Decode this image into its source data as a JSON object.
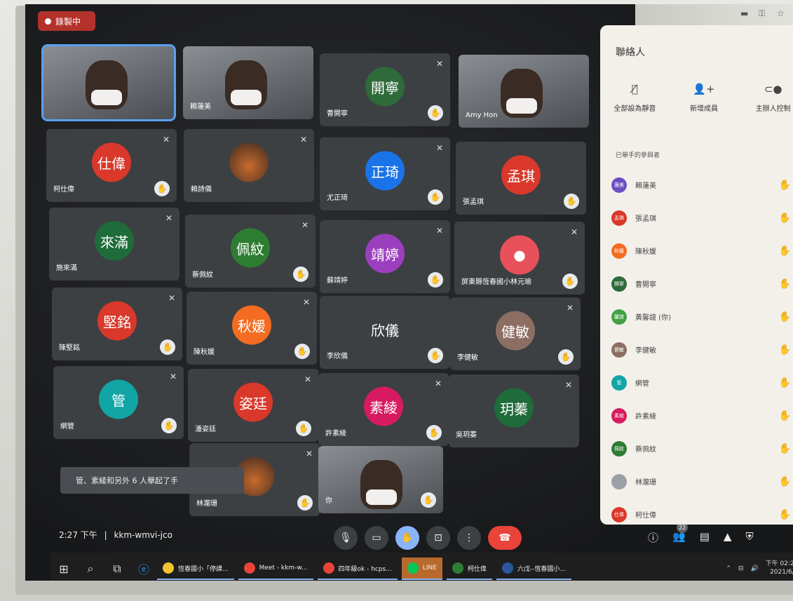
{
  "recording": {
    "label": "錄製中",
    "color": "#b3322b"
  },
  "browser": {
    "icons": [
      "ext-icon",
      "key-icon",
      "star-icon"
    ]
  },
  "tiles": [
    {
      "name": "",
      "type": "video",
      "active": true
    },
    {
      "name": "賴蓮美",
      "type": "video"
    },
    {
      "name": "曹開寧",
      "type": "avatar",
      "initials": "開寧",
      "color": "#2e6b3a",
      "muted": true,
      "hand": true
    },
    {
      "name": "Amy Hon",
      "type": "video"
    },
    {
      "name": "柯仕偉",
      "type": "avatar",
      "initials": "仕偉",
      "color": "#d9382b",
      "muted": true,
      "hand": true
    },
    {
      "name": "賴詩儀",
      "type": "photo",
      "muted": true
    },
    {
      "name": "尤正琦",
      "type": "avatar",
      "initials": "正琦",
      "color": "#1a73e8",
      "muted": true,
      "hand": true
    },
    {
      "name": "張孟琪",
      "type": "avatar",
      "initials": "孟琪",
      "color": "#d9382b",
      "hand": true
    },
    {
      "name": "施來滿",
      "type": "avatar",
      "initials": "來滿",
      "color": "#1f6b3a",
      "muted": true
    },
    {
      "name": "蔡佩紋",
      "type": "avatar",
      "initials": "佩紋",
      "color": "#2e7d32",
      "muted": true,
      "hand": true
    },
    {
      "name": "蘇靖婷",
      "type": "avatar",
      "initials": "靖婷",
      "color": "#9c3fbf",
      "muted": true,
      "hand": true
    },
    {
      "name": "屏東縣恆春國小林元瑜",
      "type": "avatar",
      "initials": "",
      "color": "#e8505b",
      "muted": true,
      "hand": true
    },
    {
      "name": "陳堅銘",
      "type": "avatar",
      "initials": "堅銘",
      "color": "#d9382b",
      "muted": true,
      "hand": true
    },
    {
      "name": "陳秋媛",
      "type": "avatar",
      "initials": "秋媛",
      "color": "#f36c21",
      "muted": true,
      "hand": true
    },
    {
      "name": "李欣儀",
      "type": "avatar",
      "initials": "欣儀",
      "color": "#3c4043",
      "hand": true
    },
    {
      "name": "李健敏",
      "type": "avatar",
      "initials": "健敏",
      "color": "#8d6e63",
      "muted": true,
      "hand": true
    },
    {
      "name": "網管",
      "type": "avatar",
      "initials": "管",
      "color": "#12a5a5",
      "muted": true,
      "hand": true
    },
    {
      "name": "潘姿廷",
      "type": "avatar",
      "initials": "姿廷",
      "color": "#d9382b",
      "muted": true,
      "hand": true
    },
    {
      "name": "許素綾",
      "type": "avatar",
      "initials": "素綾",
      "color": "#d81b60",
      "muted": true,
      "hand": true
    },
    {
      "name": "吳玥蓁",
      "type": "avatar",
      "initials": "玥蓁",
      "color": "#1f6b3a",
      "muted": true
    },
    {
      "name": "林瀧珊",
      "type": "photo",
      "muted": true,
      "hand": true
    },
    {
      "name": "你",
      "type": "video",
      "hand": true
    }
  ],
  "toast": "管、素綾和另外 6 人舉起了手",
  "meeting": {
    "time": "2:27 下午",
    "sep": "|",
    "code": "kkm-wmvi-jco"
  },
  "participant_count": "22",
  "panel": {
    "title": "聯絡人",
    "actions": [
      {
        "icon": "mic-off-icon",
        "label": "全部設為靜音"
      },
      {
        "icon": "add-person-icon",
        "label": "新增成員"
      },
      {
        "icon": "toggle-icon",
        "label": "主辦人控制"
      }
    ],
    "section": "已舉手的參與者",
    "people": [
      {
        "initials": "蓮美",
        "name": "賴蓮美",
        "color": "#6a4fc3"
      },
      {
        "initials": "孟琪",
        "name": "張孟琪",
        "color": "#d9382b"
      },
      {
        "initials": "秋媛",
        "name": "陳秋媛",
        "color": "#f36c21"
      },
      {
        "initials": "開寧",
        "name": "曹開寧",
        "color": "#2e6b3a"
      },
      {
        "initials": "馨誼",
        "name": "黃馨誼 (你)",
        "color": "#43a047"
      },
      {
        "initials": "健敏",
        "name": "李健敏",
        "color": "#8d6e63"
      },
      {
        "initials": "管",
        "name": "網管",
        "color": "#12a5a5"
      },
      {
        "initials": "素綾",
        "name": "許素綾",
        "color": "#d81b60"
      },
      {
        "initials": "佩紋",
        "name": "蔡佩紋",
        "color": "#2e7d32"
      },
      {
        "initials": "",
        "name": "林瀧珊",
        "color": "#9aa0a6"
      },
      {
        "initials": "仕偉",
        "name": "柯仕偉",
        "color": "#d9382b"
      }
    ]
  },
  "taskbar": {
    "apps": [
      {
        "label": "恆春國小「停課...",
        "color": "#f4c430"
      },
      {
        "label": "Meet - kkm-w...",
        "color": "#e8443a"
      },
      {
        "label": "四年級ok - hcps...",
        "color": "#e8443a"
      },
      {
        "label": "LINE",
        "color": "#06c755"
      },
      {
        "label": "柯仕偉",
        "color": "#2e7d32"
      },
      {
        "label": "六戊--恆春國小...",
        "color": "#2b579a"
      }
    ],
    "clock_time": "下午 02:27",
    "clock_date": "2021/6/8"
  }
}
